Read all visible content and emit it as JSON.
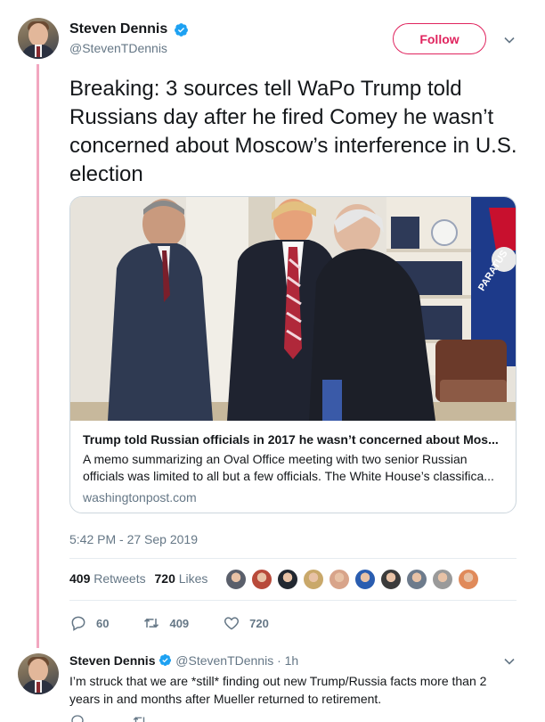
{
  "tweet": {
    "display_name": "Steven Dennis",
    "handle": "@StevenTDennis",
    "follow_label": "Follow",
    "text": "Breaking: 3 sources tell WaPo Trump told Russians day after he fired Comey he wasn’t concerned about Moscow’s interference in U.S. election",
    "timestamp": "5:42 PM - 27 Sep 2019",
    "retweets_count": "409",
    "retweets_label": "Retweets",
    "likes_count": "720",
    "likes_label": "Likes",
    "reply_count": "60",
    "retweet_action_count": "409",
    "like_action_count": "720"
  },
  "card": {
    "title": "Trump told Russian officials in 2017 he wasn’t concerned about Mos...",
    "description": "A memo summarizing an Oval Office meeting with two senior Russian officials was limited to all but a few officials. The White House’s classifica...",
    "domain": "washingtonpost.com",
    "image_flag_text": "PARATUS"
  },
  "reply": {
    "display_name": "Steven Dennis",
    "handle": "@StevenTDennis",
    "time": "· 1h",
    "text": "I’m struck that we are *still* finding out new Trump/Russia facts more than 2 years in and months after Mueller returned to retirement."
  },
  "likers": [
    "#5a5f6b",
    "#b84a3a",
    "#222831",
    "#c9a86a",
    "#d8a48a",
    "#2a5db0",
    "#3b3b3b",
    "#6d7b8c",
    "#9a9a9a",
    "#e08a5a"
  ],
  "colors": {
    "accent": "#e0245e",
    "verified": "#1da1f2",
    "muted": "#657786",
    "thread_line": "#f2a7c0"
  }
}
